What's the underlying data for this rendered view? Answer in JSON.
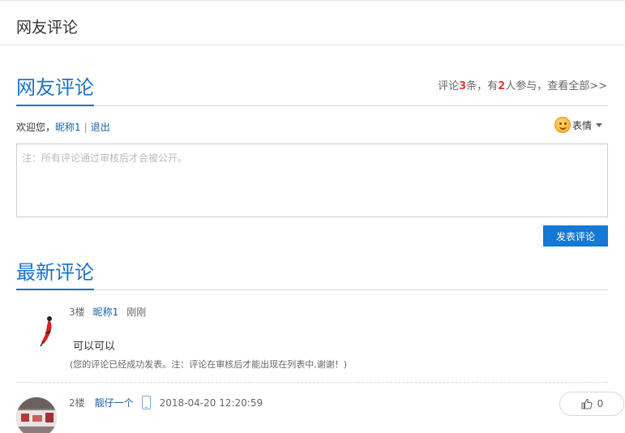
{
  "header": {
    "title": "网友评论"
  },
  "comment_section": {
    "title": "网友评论",
    "stats": {
      "prefix": "评论",
      "comment_count": "3",
      "mid": "条，有",
      "participant_count": "2",
      "suffix": "人参与，",
      "view_all": "查看全部>>"
    },
    "welcome": {
      "text": "欢迎您，",
      "nickname": "昵称1",
      "separator": "|",
      "logout": "退出"
    },
    "emoji": {
      "label": "表情",
      "icon": "smiley-icon"
    },
    "input": {
      "placeholder": "注：所有评论通过审核后才会被公开。",
      "value": ""
    },
    "submit_label": "发表评论"
  },
  "latest": {
    "title": "最新评论",
    "comments": [
      {
        "floor": "3楼",
        "nickname": "昵称1",
        "time": "刚刚",
        "text": "可以可以",
        "note": "(您的评论已经成功发表。注：评论在审核后才能出现在列表中,谢谢！)"
      },
      {
        "floor": "2楼",
        "nickname": "靓仔一个",
        "device_icon": "mobile-phone-icon",
        "time": "2018-04-20 12:20:59",
        "likes": "0"
      }
    ]
  },
  "colors": {
    "accent": "#1a73c8",
    "highlight": "#e23b3b",
    "button": "#1478d4"
  }
}
